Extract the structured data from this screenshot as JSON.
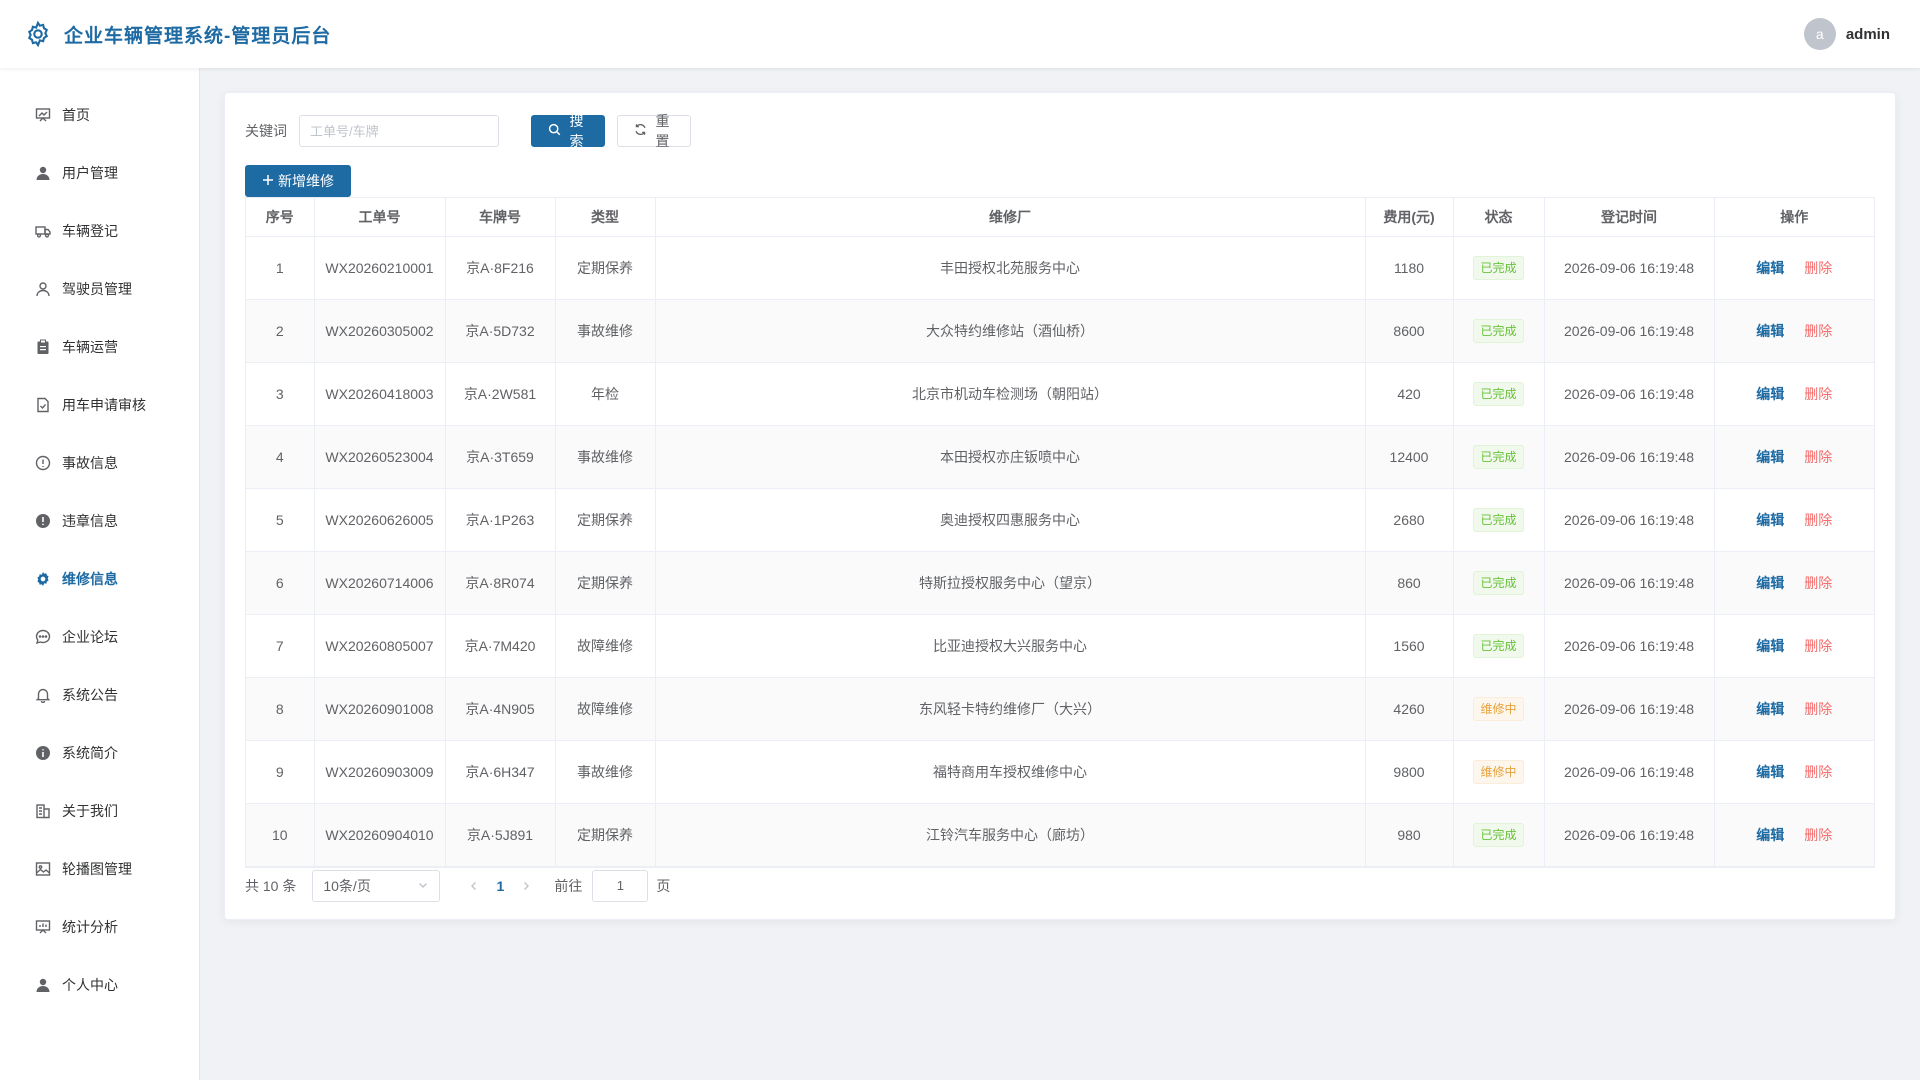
{
  "header": {
    "title": "企业车辆管理系统-管理员后台",
    "user": {
      "avatar_letter": "a",
      "name": "admin"
    }
  },
  "sidebar": {
    "items": [
      {
        "label": "首页",
        "icon": "chart-board-icon",
        "active": false
      },
      {
        "label": "用户管理",
        "icon": "user-filled-icon",
        "active": false
      },
      {
        "label": "车辆登记",
        "icon": "truck-icon",
        "active": false
      },
      {
        "label": "驾驶员管理",
        "icon": "user-outline-icon",
        "active": false
      },
      {
        "label": "车辆运营",
        "icon": "clipboard-icon",
        "active": false
      },
      {
        "label": "用车申请审核",
        "icon": "document-check-icon",
        "active": false
      },
      {
        "label": "事故信息",
        "icon": "warning-outline-icon",
        "active": false
      },
      {
        "label": "违章信息",
        "icon": "warning-filled-icon",
        "active": false
      },
      {
        "label": "维修信息",
        "icon": "gear-icon",
        "active": true
      },
      {
        "label": "企业论坛",
        "icon": "chat-dot-icon",
        "active": false
      },
      {
        "label": "系统公告",
        "icon": "bell-icon",
        "active": false
      },
      {
        "label": "系统简介",
        "icon": "info-filled-icon",
        "active": false
      },
      {
        "label": "关于我们",
        "icon": "office-building-icon",
        "active": false
      },
      {
        "label": "轮播图管理",
        "icon": "picture-icon",
        "active": false
      },
      {
        "label": "统计分析",
        "icon": "data-board-icon",
        "active": false
      },
      {
        "label": "个人中心",
        "icon": "user-filled-icon",
        "active": false
      }
    ]
  },
  "search": {
    "label": "关键词",
    "placeholder": "工单号/车牌",
    "value": "",
    "search_button": "搜索",
    "reset_button": "重置",
    "add_button": "新增维修"
  },
  "table": {
    "columns": [
      "序号",
      "工单号",
      "车牌号",
      "类型",
      "维修厂",
      "费用(元)",
      "状态",
      "登记时间",
      "操作"
    ],
    "edit_label": "编辑",
    "delete_label": "删除",
    "rows": [
      {
        "index": "1",
        "order_no": "WX20260210001",
        "plate": "京A·8F216",
        "type": "定期保养",
        "shop": "丰田授权北苑服务中心",
        "cost": "1180",
        "status": "已完成",
        "time": "2026-09-06 16:19:48"
      },
      {
        "index": "2",
        "order_no": "WX20260305002",
        "plate": "京A·5D732",
        "type": "事故维修",
        "shop": "大众特约维修站（酒仙桥）",
        "cost": "8600",
        "status": "已完成",
        "time": "2026-09-06 16:19:48"
      },
      {
        "index": "3",
        "order_no": "WX20260418003",
        "plate": "京A·2W581",
        "type": "年检",
        "shop": "北京市机动车检测场（朝阳站）",
        "cost": "420",
        "status": "已完成",
        "time": "2026-09-06 16:19:48"
      },
      {
        "index": "4",
        "order_no": "WX20260523004",
        "plate": "京A·3T659",
        "type": "事故维修",
        "shop": "本田授权亦庄钣喷中心",
        "cost": "12400",
        "status": "已完成",
        "time": "2026-09-06 16:19:48"
      },
      {
        "index": "5",
        "order_no": "WX20260626005",
        "plate": "京A·1P263",
        "type": "定期保养",
        "shop": "奥迪授权四惠服务中心",
        "cost": "2680",
        "status": "已完成",
        "time": "2026-09-06 16:19:48"
      },
      {
        "index": "6",
        "order_no": "WX20260714006",
        "plate": "京A·8R074",
        "type": "定期保养",
        "shop": "特斯拉授权服务中心（望京）",
        "cost": "860",
        "status": "已完成",
        "time": "2026-09-06 16:19:48"
      },
      {
        "index": "7",
        "order_no": "WX20260805007",
        "plate": "京A·7M420",
        "type": "故障维修",
        "shop": "比亚迪授权大兴服务中心",
        "cost": "1560",
        "status": "已完成",
        "time": "2026-09-06 16:19:48"
      },
      {
        "index": "8",
        "order_no": "WX20260901008",
        "plate": "京A·4N905",
        "type": "故障维修",
        "shop": "东风轻卡特约维修厂（大兴）",
        "cost": "4260",
        "status": "维修中",
        "time": "2026-09-06 16:19:48"
      },
      {
        "index": "9",
        "order_no": "WX20260903009",
        "plate": "京A·6H347",
        "type": "事故维修",
        "shop": "福特商用车授权维修中心",
        "cost": "9800",
        "status": "维修中",
        "time": "2026-09-06 16:19:48"
      },
      {
        "index": "10",
        "order_no": "WX20260904010",
        "plate": "京A·5J891",
        "type": "定期保养",
        "shop": "江铃汽车服务中心（廊坊）",
        "cost": "980",
        "status": "已完成",
        "time": "2026-09-06 16:19:48"
      }
    ]
  },
  "pagination": {
    "total_text": "共 10 条",
    "page_size": "10条/页",
    "current_page": "1",
    "goto_label": "前往",
    "goto_value": "1",
    "page_suffix": "页"
  },
  "colors": {
    "accent": "#1e6aa3",
    "done": "#67c23a",
    "doing": "#e6a23c",
    "danger": "#f56c6c"
  }
}
